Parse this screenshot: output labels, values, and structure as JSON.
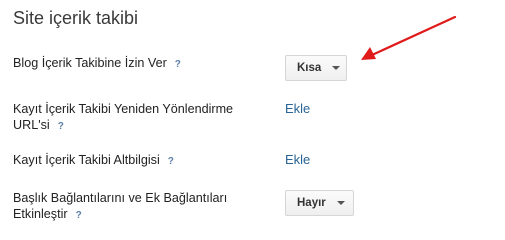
{
  "section": {
    "title": "Site içerik takibi"
  },
  "rows": [
    {
      "label": "Blog İçerik Takibine İzin Ver",
      "help": "?",
      "control": "Kısa"
    },
    {
      "label_line1": "Kayıt İçerik Takibi Yeniden Yönlendirme",
      "label_line2": "URL'si",
      "help": "?",
      "control": "Ekle"
    },
    {
      "label": "Kayıt İçerik Takibi Altbilgisi",
      "help": "?",
      "control": "Ekle"
    },
    {
      "label_line1": "Başlık Bağlantılarını ve Ek Bağlantıları",
      "label_line2": "Etkinleştir",
      "help": "?",
      "control": "Hayır"
    }
  ],
  "colors": {
    "link": "#2a6496",
    "help": "#5b7fa6",
    "annotation_arrow": "#e01b1b"
  },
  "icons": {
    "dropdown": "chevron-down-icon",
    "annotation": "red-arrow-icon"
  }
}
